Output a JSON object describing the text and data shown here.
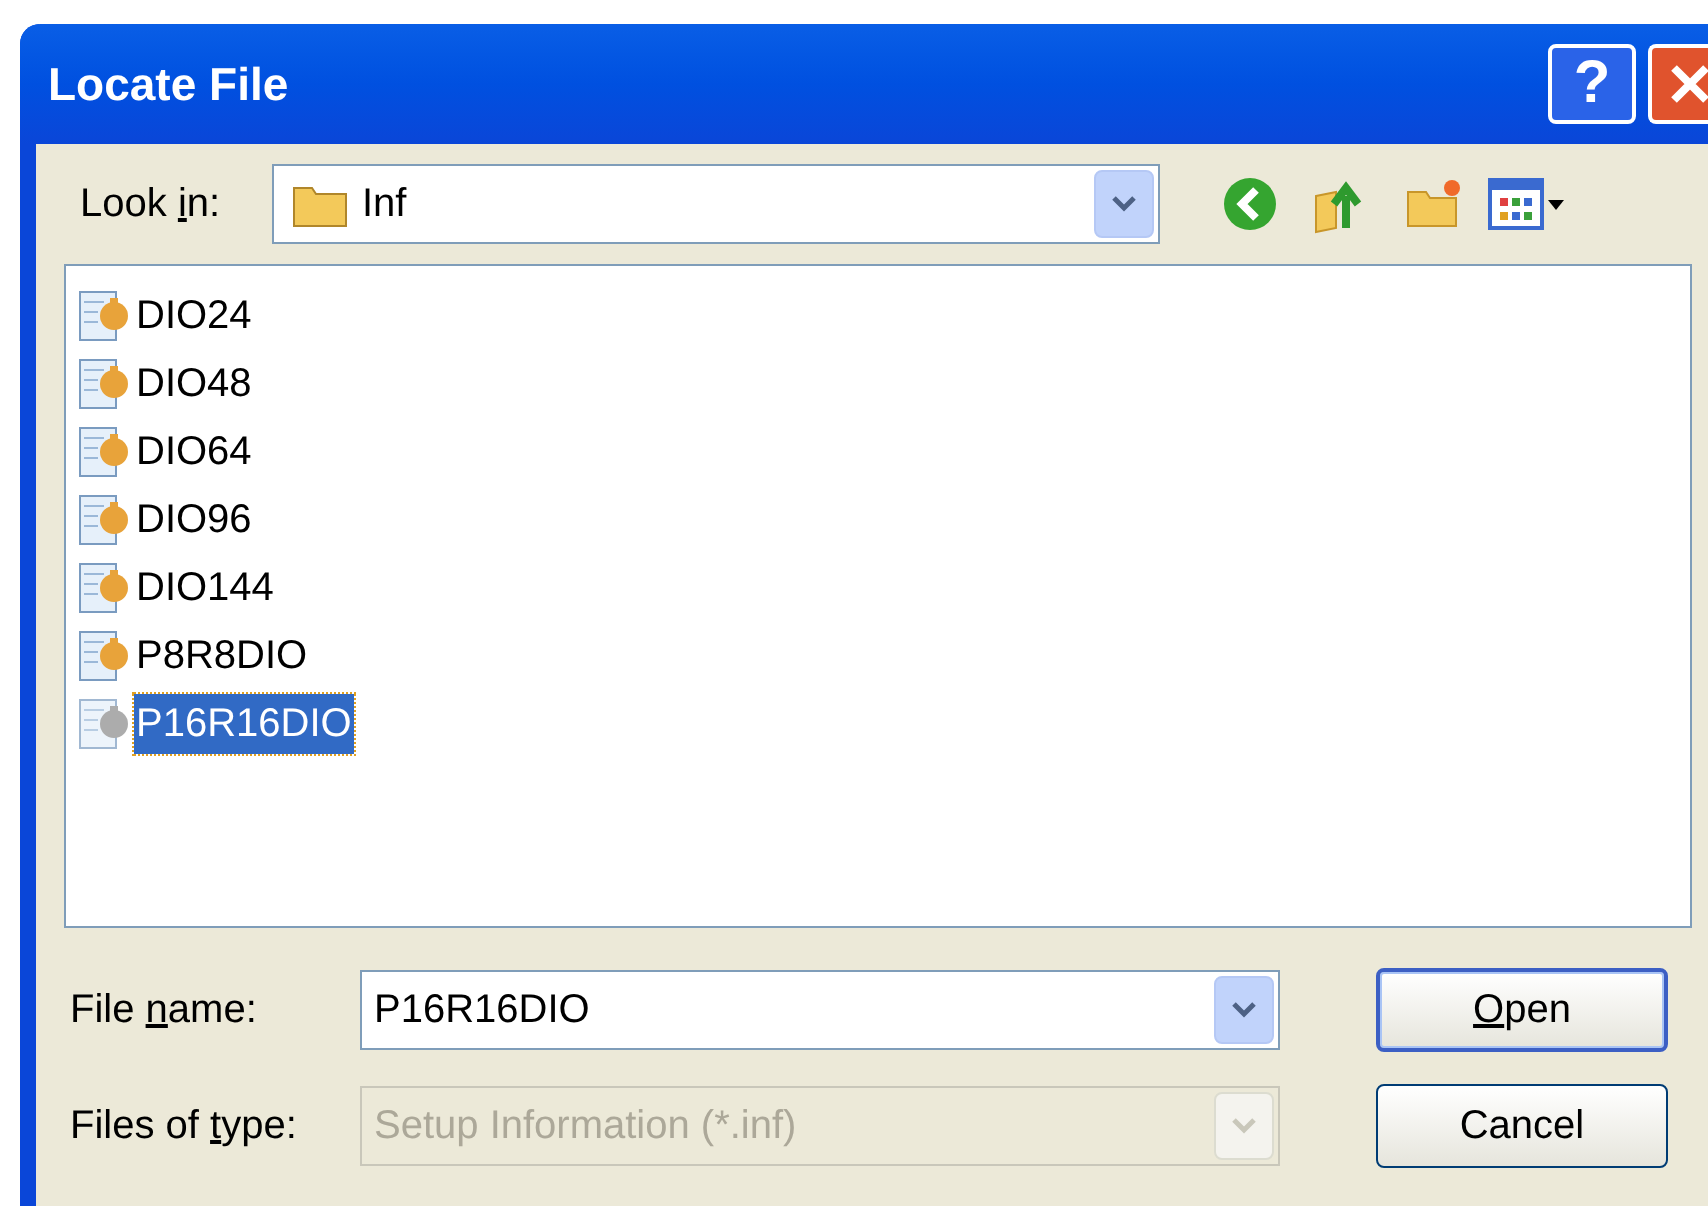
{
  "window": {
    "title": "Locate File",
    "buttons": [
      {
        "kind": "help",
        "label": "?"
      },
      {
        "kind": "close"
      }
    ]
  },
  "look_in": {
    "label_parts": {
      "before": "Look ",
      "key": "i",
      "after": "n:"
    },
    "value": "Inf"
  },
  "toolbar": [
    {
      "kind": "back"
    },
    {
      "kind": "up"
    },
    {
      "kind": "new-folder"
    },
    {
      "kind": "views"
    }
  ],
  "files": [
    {
      "name": "DIO24",
      "selected": false
    },
    {
      "name": "DIO48",
      "selected": false
    },
    {
      "name": "DIO64",
      "selected": false
    },
    {
      "name": "DIO96",
      "selected": false
    },
    {
      "name": "DIO144",
      "selected": false
    },
    {
      "name": "P8R8DIO",
      "selected": false
    },
    {
      "name": "P16R16DIO",
      "selected": true
    }
  ],
  "file_name": {
    "label_parts": {
      "before": "File ",
      "key": "n",
      "after": "ame:"
    },
    "value": "P16R16DIO",
    "disabled": false
  },
  "file_type": {
    "label_parts": {
      "before": "Files of ",
      "key": "t",
      "after": "ype:"
    },
    "value": "Setup Information (*.inf)",
    "disabled": true
  },
  "buttons": [
    {
      "label_parts": {
        "key": "O",
        "after": "pen"
      },
      "default": true
    },
    {
      "label_parts": {
        "before": "Cancel"
      },
      "default": false
    }
  ]
}
